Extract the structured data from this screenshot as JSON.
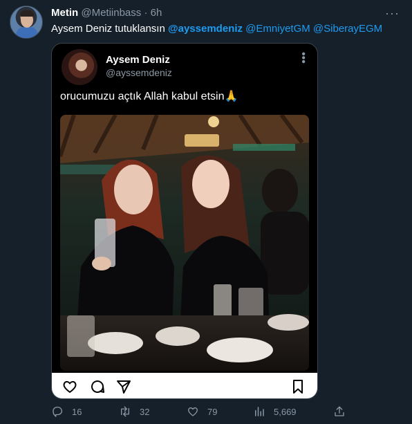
{
  "tweet": {
    "author_name": "Metin",
    "author_handle": "@Metiinbass",
    "separator": "·",
    "time": "6h",
    "text_prefix": "Aysem Deniz tutuklansın ",
    "mentions": [
      "@ayssemdeniz",
      "@EmniyetGM",
      "@SiberayEGM"
    ]
  },
  "embedded": {
    "name": "Aysem Deniz",
    "handle": "@ayssemdeniz",
    "text": "orucumuzu açtık Allah kabul etsin🙏",
    "action_icons": [
      "heart-outline-icon",
      "comment-icon",
      "share-send-icon",
      "bookmark-icon"
    ]
  },
  "footer": {
    "replies": "16",
    "retweets": "32",
    "likes": "79",
    "views": "5,669"
  },
  "colors": {
    "background": "#15202b",
    "accent": "#1d9bf0",
    "muted": "#8b98a5",
    "border": "#38444d"
  }
}
